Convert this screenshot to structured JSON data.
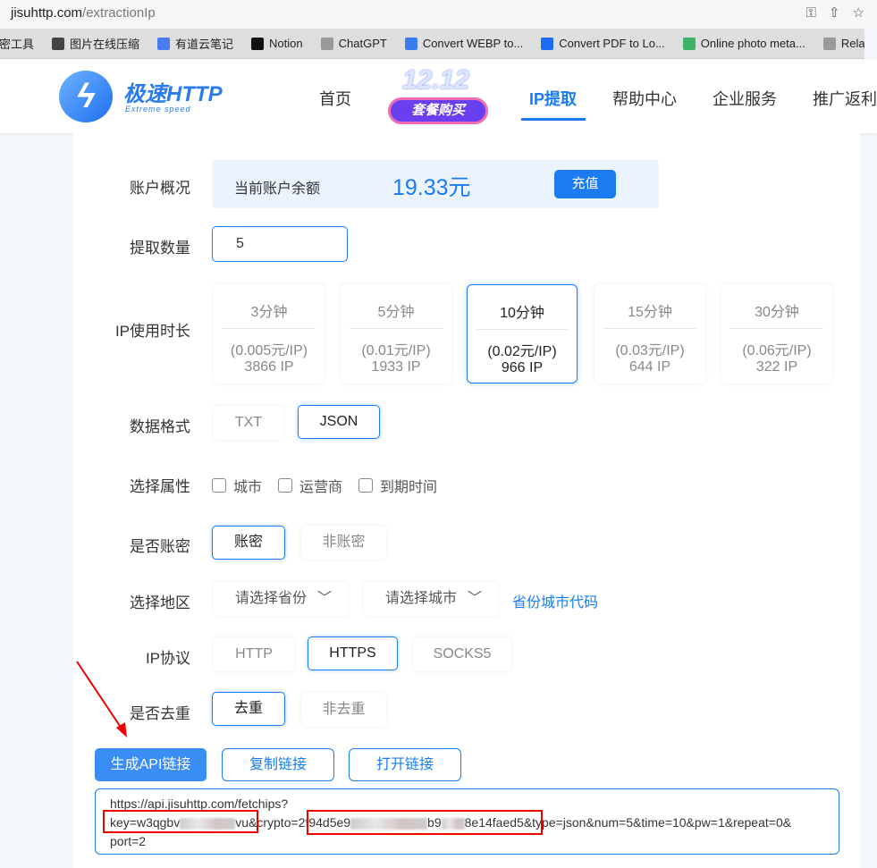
{
  "browser": {
    "domain": "jisuhttp.com",
    "path": "/extractionIp",
    "bookmarks": [
      {
        "label": "加密工具",
        "color": "#666"
      },
      {
        "label": "图片在线压缩",
        "color": "#444"
      },
      {
        "label": "有道云笔记",
        "color": "#4a7cf0"
      },
      {
        "label": "Notion",
        "color": "#111"
      },
      {
        "label": "ChatGPT",
        "color": "#999"
      },
      {
        "label": "Convert WEBP to...",
        "color": "#3a7cf0"
      },
      {
        "label": "Convert PDF to Lo...",
        "color": "#1a6cf0"
      },
      {
        "label": "Online photo meta...",
        "color": "#3bb36b"
      },
      {
        "label": "Relakkes",
        "color": "#999"
      }
    ]
  },
  "header": {
    "logo_text": "极速HTTP",
    "logo_sub": "Extreme speed",
    "promo_number": "12.12",
    "promo_label": "套餐购买",
    "nav": [
      {
        "label": "首页"
      },
      {
        "label": "IP提取",
        "active": true
      },
      {
        "label": "帮助中心"
      },
      {
        "label": "企业服务"
      },
      {
        "label": "推广返利"
      }
    ]
  },
  "form": {
    "account": {
      "label": "账户概况",
      "balance_label": "当前账户余额",
      "balance": "19.33元",
      "recharge": "充值"
    },
    "quantity": {
      "label": "提取数量",
      "value": "5"
    },
    "duration": {
      "label": "IP使用时长",
      "options": [
        {
          "time": "3分钟",
          "price": "(0.005元/IP)",
          "count": "3866 IP"
        },
        {
          "time": "5分钟",
          "price": "(0.01元/IP)",
          "count": "1933 IP"
        },
        {
          "time": "10分钟",
          "price": "(0.02元/IP)",
          "count": "966 IP",
          "selected": true
        },
        {
          "time": "15分钟",
          "price": "(0.03元/IP)",
          "count": "644 IP"
        },
        {
          "time": "30分钟",
          "price": "(0.06元/IP)",
          "count": "322 IP"
        }
      ]
    },
    "format": {
      "label": "数据格式",
      "options": [
        "TXT",
        "JSON"
      ],
      "selected": "JSON"
    },
    "attributes": {
      "label": "选择属性",
      "options": [
        "城市",
        "运营商",
        "到期时间"
      ]
    },
    "auth": {
      "label": "是否账密",
      "options": [
        "账密",
        "非账密"
      ],
      "selected": "账密"
    },
    "region": {
      "label": "选择地区",
      "province_placeholder": "请选择省份",
      "city_placeholder": "请选择城市",
      "code_link": "省份城市代码"
    },
    "protocol": {
      "label": "IP协议",
      "options": [
        "HTTP",
        "HTTPS",
        "SOCKS5"
      ],
      "selected": "HTTPS"
    },
    "dedup": {
      "label": "是否去重",
      "options": [
        "去重",
        "非去重"
      ],
      "selected": "去重"
    },
    "actions": {
      "generate": "生成API链接",
      "copy": "复制链接",
      "open": "打开链接"
    },
    "api_url": {
      "line1": "https://api.jisuhttp.com/fetchips?",
      "key_prefix": "key=w3qgbv",
      "key_suffix": "vu",
      "crypto_prefix": "&crypto=2f94d5e9",
      "crypto_mid": "b9",
      "crypto_suffix": "8e14faed5",
      "rest": "&type=json&num=5&time=10&pw=1&repeat=0&",
      "line3": "port=2"
    }
  },
  "colors": {
    "accent": "#1a7cf0",
    "annotation": "#e00000"
  }
}
